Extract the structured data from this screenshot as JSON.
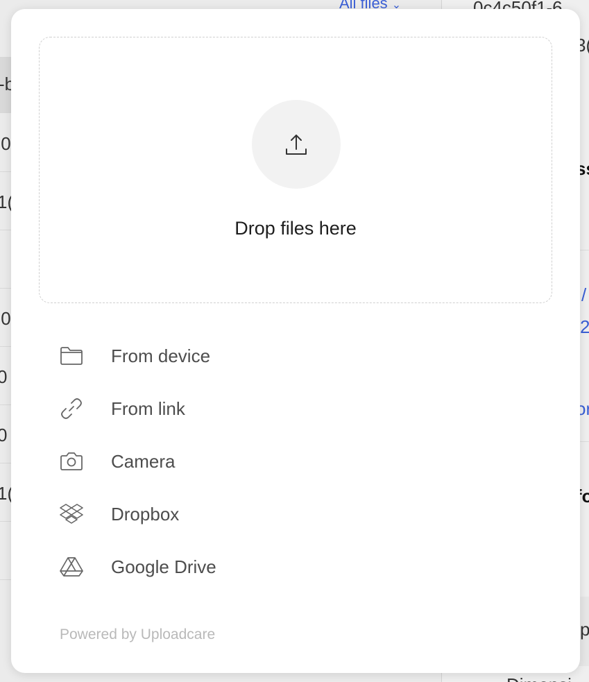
{
  "background": {
    "filter_label": "All files",
    "left_fragments": [
      "-b",
      ".0",
      "1(",
      ".0",
      "0",
      "0",
      "1("
    ],
    "right_fragments": [
      "0c4c50f1-6",
      "3(",
      "ss",
      "/",
      "2",
      "or",
      "fo",
      "p",
      "Dimensi"
    ]
  },
  "dropzone": {
    "label": "Drop files here"
  },
  "sources": [
    {
      "id": "device",
      "label": "From device",
      "icon": "folder-icon"
    },
    {
      "id": "link",
      "label": "From link",
      "icon": "link-icon"
    },
    {
      "id": "camera",
      "label": "Camera",
      "icon": "camera-icon"
    },
    {
      "id": "dropbox",
      "label": "Dropbox",
      "icon": "dropbox-icon"
    },
    {
      "id": "gdrive",
      "label": "Google Drive",
      "icon": "google-drive-icon"
    }
  ],
  "footer": {
    "powered_by": "Powered by Uploadcare"
  },
  "colors": {
    "link": "#3a5fd6",
    "modal_bg": "#ffffff",
    "icon_circle": "#f2f2f2",
    "muted_text": "#b9b9b9"
  }
}
